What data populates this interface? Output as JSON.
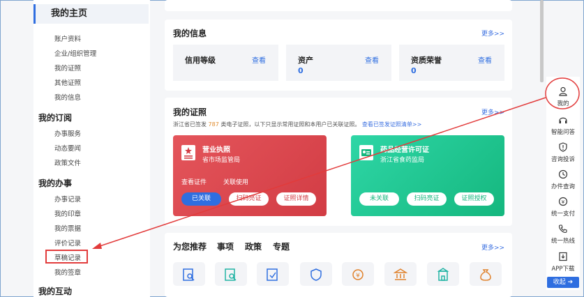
{
  "sidebar": {
    "home_title": "我的主页",
    "home_items": [
      "账户资料",
      "企业/组织管理",
      "我的证照",
      "其他证照",
      "我的信息"
    ],
    "subscribe_title": "我的订阅",
    "subscribe_items": [
      "办事服务",
      "动态要闻",
      "政策文件"
    ],
    "affairs_title": "我的办事",
    "affairs_items": [
      "办事记录",
      "我的印章",
      "我的票据",
      "评价记录",
      "草稿记录",
      "我的签章"
    ],
    "interact_title": "我的互动"
  },
  "info": {
    "title": "我的信息",
    "more": "更多>>",
    "boxes": [
      {
        "label": "信用等级",
        "view": "查看",
        "value": ""
      },
      {
        "label": "资产",
        "view": "查看",
        "value": "0"
      },
      {
        "label": "资质荣誉",
        "view": "查看",
        "value": "0"
      }
    ]
  },
  "license": {
    "title": "我的证照",
    "more": "更多>>",
    "desc_prefix": "浙江省已签发",
    "desc_count": "787",
    "desc_suffix": "类电子证照，以下只显示常用证照和本用户已关联证照。",
    "desc_link": "查看已签发证照清单>>",
    "cards": [
      {
        "name": "营业执照",
        "org": "省市场监管局",
        "link1": "查看证件",
        "link2": "关联使用",
        "btn1": "已关联",
        "btn2": "扫码亮证",
        "btn3": "证照详情"
      },
      {
        "name": "药品经营许可证",
        "org": "浙江省食药监局",
        "btn1": "未关联",
        "btn2": "扫码亮证",
        "btn3": "证照授权"
      }
    ]
  },
  "recommend": {
    "title": "为您推荐",
    "tabs": [
      "事项",
      "政策",
      "专题"
    ],
    "more": "更多>>",
    "icons": [
      "doc-search-icon",
      "doc-search-icon",
      "doc-check-icon",
      "shield-badge-icon",
      "coin-icon",
      "bank-icon",
      "building-icon",
      "money-bag-icon"
    ]
  },
  "rail": {
    "items": [
      "我的",
      "智能问答",
      "咨询投诉",
      "办件查询",
      "统一支付",
      "统一热线",
      "APP下载"
    ],
    "collapse": "收起"
  },
  "colors": {
    "accent": "#2f6ee0",
    "red_card": "#d23c44",
    "green_card": "#15b77e",
    "highlight": "#e23b3b"
  }
}
